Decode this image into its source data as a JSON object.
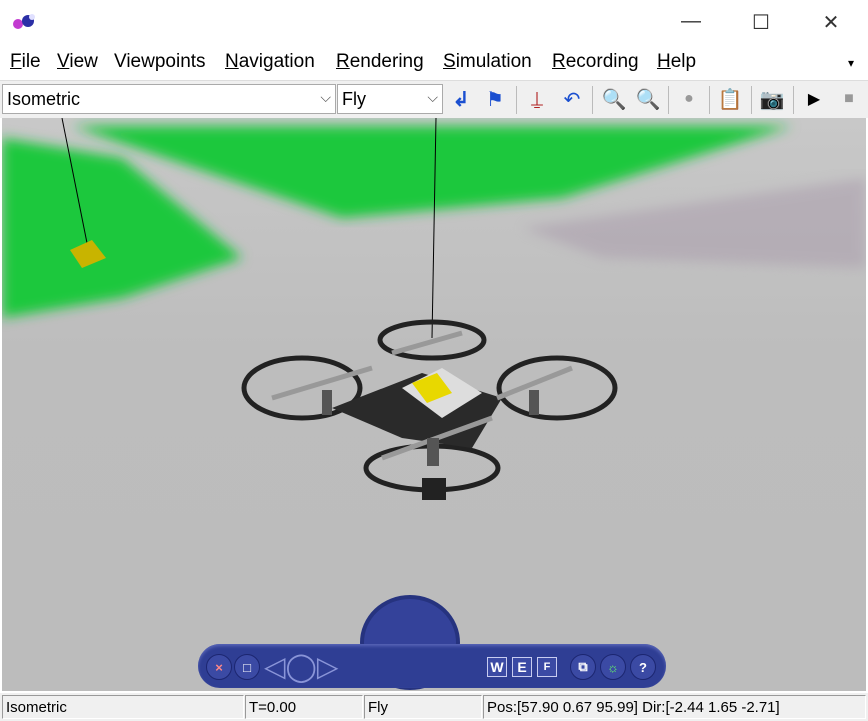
{
  "window": {
    "minimize": "—",
    "maximize": "☐",
    "close": "✕"
  },
  "menu": [
    {
      "label": "File",
      "accel": "F",
      "rest": "ile"
    },
    {
      "label": "View",
      "accel": "V",
      "rest": "iew"
    },
    {
      "label": "Viewpoints",
      "accel": "",
      "rest": "Viewpoints"
    },
    {
      "label": "Navigation",
      "accel": "N",
      "rest": "avigation"
    },
    {
      "label": "Rendering",
      "accel": "R",
      "rest": "endering"
    },
    {
      "label": "Simulation",
      "accel": "S",
      "rest": "imulation"
    },
    {
      "label": "Recording",
      "accel": "R",
      "rest": "ecording"
    },
    {
      "label": "Help",
      "accel": "H",
      "rest": "elp"
    }
  ],
  "toolbar": {
    "viewpoint": "Isometric",
    "nav_mode": "Fly"
  },
  "icons": [
    "return-icon",
    "flag-icon",
    "straighten-up-icon",
    "undo-move-icon",
    "zoom-in-icon",
    "zoom-out-icon",
    "record-icon",
    "properties-icon",
    "camera-icon",
    "play-icon",
    "stop-icon"
  ],
  "nav_panel": {
    "close": "×",
    "restore": "□",
    "w": "W",
    "e": "E",
    "f": "F",
    "help": "?"
  },
  "status": {
    "viewpoint": "Isometric",
    "time": "T=0.00",
    "mode": "Fly",
    "pos": "Pos:[57.90 0.67 95.99] Dir:[-2.44 1.65 -2.71]"
  },
  "colors": {
    "ground": "#bcbcbc",
    "grass": "#1ec83c",
    "nav": "#2f3e94",
    "toolbar_icon": "#1a4fd0"
  }
}
